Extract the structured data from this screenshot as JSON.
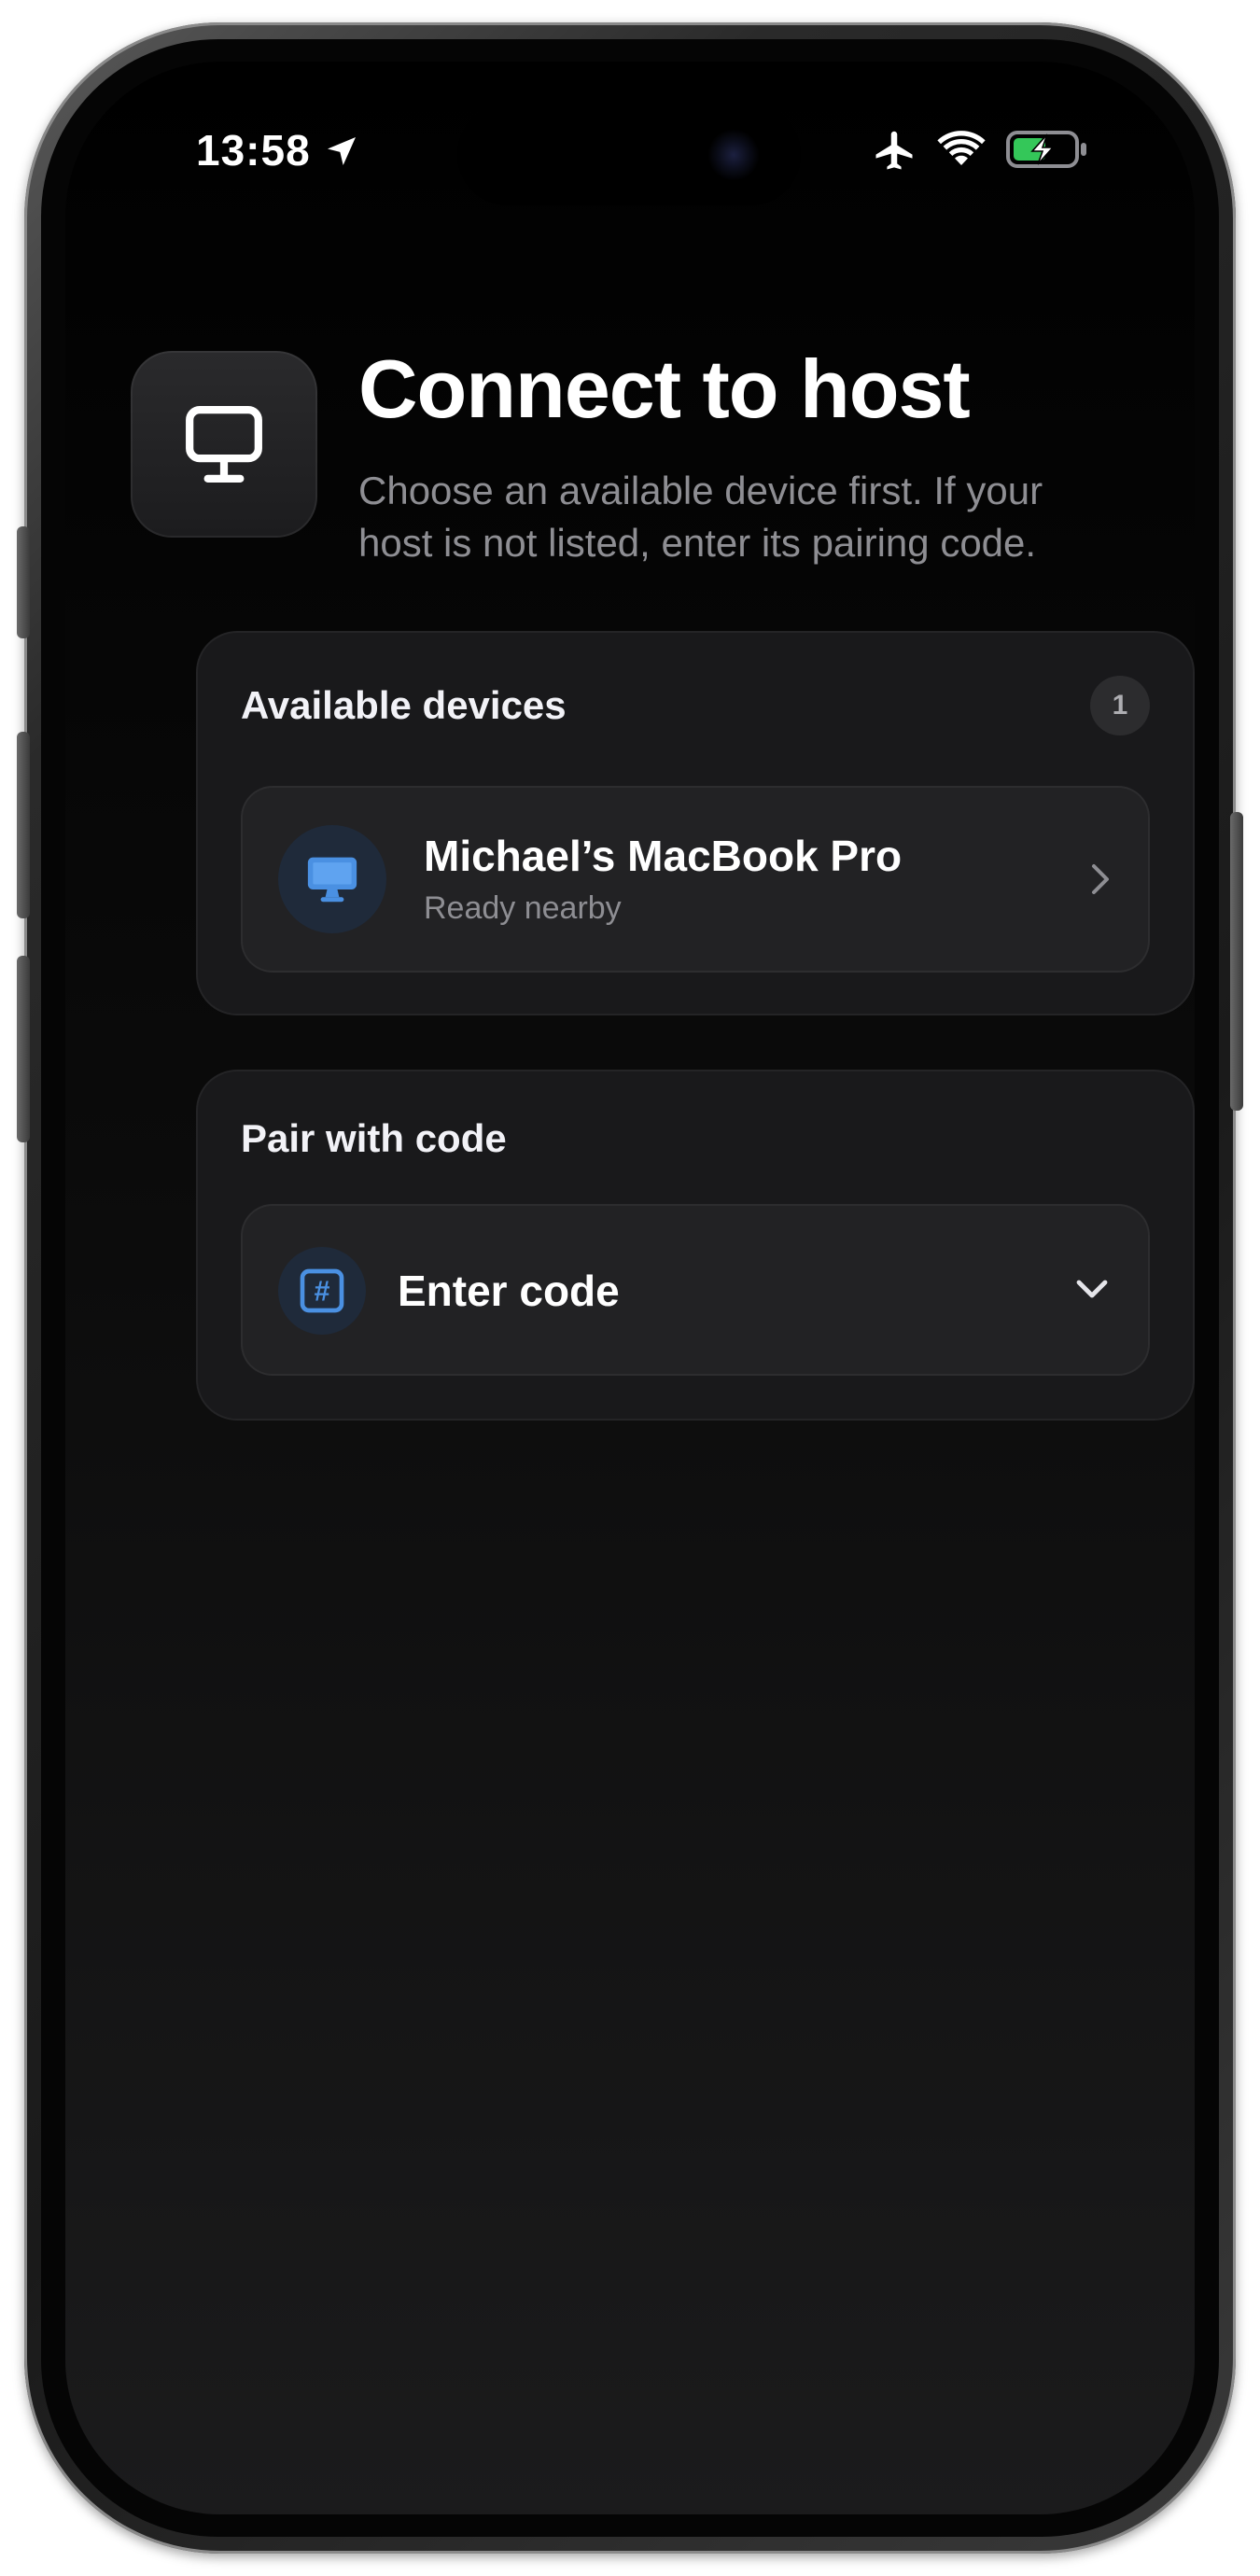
{
  "status_bar": {
    "time": "13:58",
    "icons": [
      "location-arrow-icon",
      "airplane-icon",
      "wifi-icon",
      "battery-charging-icon"
    ],
    "battery_color": "#34c759"
  },
  "header": {
    "icon": "desktop-monitor-icon",
    "title": "Connect to host",
    "subtitle": "Choose an available device first. If your host is not listed, enter its pairing code."
  },
  "available_devices": {
    "title": "Available devices",
    "count": "1",
    "items": [
      {
        "icon": "desktop-computer-icon",
        "name": "Michael’s MacBook Pro",
        "status": "Ready nearby"
      }
    ]
  },
  "pair_with_code": {
    "title": "Pair with code",
    "icon": "hash-icon",
    "field_label": "Enter code"
  },
  "colors": {
    "accent": "#4a90e2",
    "card_background": "#19191b",
    "row_background": "#222224",
    "secondary_text": "#8e8e93"
  }
}
